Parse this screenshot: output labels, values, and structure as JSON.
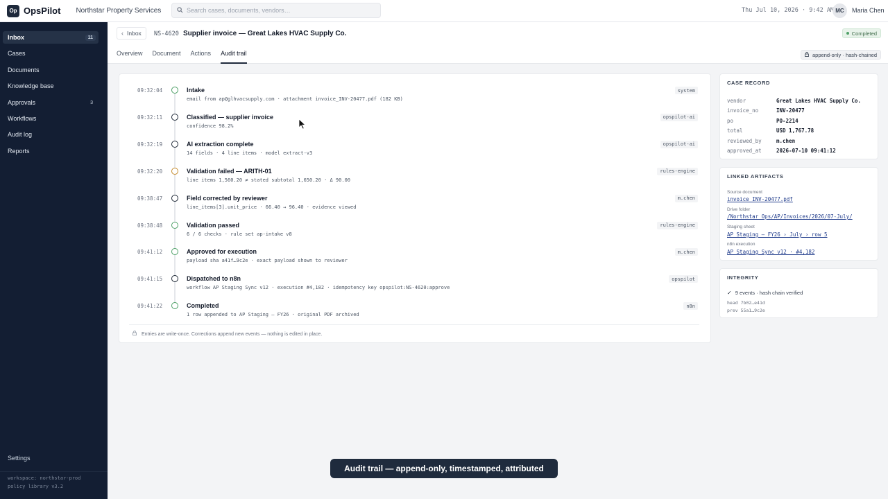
{
  "app": {
    "name": "OpsPilot",
    "logo_text": "Op",
    "org": "Northstar Property Services"
  },
  "search": {
    "placeholder": "Search cases, documents, vendors…"
  },
  "header_right": {
    "datetime": "Thu Jul 10, 2026 · 9:42 AM",
    "initials": "MC",
    "user": "Maria Chen"
  },
  "sidebar": {
    "items": [
      {
        "label": "Inbox",
        "count": "11"
      },
      {
        "label": "Cases"
      },
      {
        "label": "Documents"
      },
      {
        "label": "Knowledge base"
      },
      {
        "label": "Approvals",
        "count": "3"
      },
      {
        "label": "Workflows"
      },
      {
        "label": "Audit log"
      },
      {
        "label": "Reports"
      }
    ],
    "settings": "Settings",
    "workspace": "workspace: northstar-prod",
    "policy": "policy library v3.2"
  },
  "case": {
    "back_label": "Inbox",
    "id": "NS-4620",
    "title": "Supplier invoice — Great Lakes HVAC Supply Co.",
    "status": "Completed",
    "tabs": [
      "Overview",
      "Document",
      "Actions",
      "Audit trail"
    ],
    "active_tab": "Audit trail",
    "chain_chip": "append-only · hash-chained"
  },
  "audit": {
    "events": [
      {
        "time": "09:32:04",
        "title": "Intake",
        "detail": "email from ap@glhvacsupply.com · attachment invoice_INV-20477.pdf (182 KB)",
        "actor": "system",
        "marker": "green"
      },
      {
        "time": "09:32:11",
        "title": "Classified — supplier invoice",
        "detail": "confidence 98.2%",
        "actor": "opspilot-ai",
        "marker": "dark"
      },
      {
        "time": "09:32:19",
        "title": "AI extraction complete",
        "detail": "14 fields · 4 line items · model extract-v3",
        "actor": "opspilot-ai",
        "marker": "dark"
      },
      {
        "time": "09:32:20",
        "title": "Validation failed — ARITH-01",
        "detail": "line items 1,560.20 ≠ stated subtotal 1,650.20 · Δ 90.00",
        "actor": "rules-engine",
        "marker": "amber"
      },
      {
        "time": "09:38:47",
        "title": "Field corrected by reviewer",
        "detail": "line_items[3].unit_price · 66.40 → 96.40 · evidence viewed",
        "actor": "m.chen",
        "marker": "dark"
      },
      {
        "time": "09:38:48",
        "title": "Validation passed",
        "detail": "6 / 6 checks · rule set ap-intake v8",
        "actor": "rules-engine",
        "marker": "green"
      },
      {
        "time": "09:41:12",
        "title": "Approved for execution",
        "detail": "payload sha a41f…9c2e · exact payload shown to reviewer",
        "actor": "m.chen",
        "marker": "green"
      },
      {
        "time": "09:41:15",
        "title": "Dispatched to n8n",
        "detail": "workflow AP Staging Sync v12 · execution #4,182 · idempotency key opspilot:NS-4620:approve",
        "actor": "opspilot",
        "marker": "dark"
      },
      {
        "time": "09:41:22",
        "title": "Completed",
        "detail": "1 row appended to AP Staging — FY26 · original PDF archived",
        "actor": "n8n",
        "marker": "green"
      }
    ],
    "footer": "Entries are write-once. Corrections append new events — nothing is edited in place."
  },
  "case_record": {
    "title": "CASE RECORD",
    "rows": [
      {
        "key": "vendor",
        "value": "Great Lakes HVAC Supply Co."
      },
      {
        "key": "invoice_no",
        "value": "INV-20477"
      },
      {
        "key": "po",
        "value": "PO-2214"
      },
      {
        "key": "total",
        "value": "USD 1,767.78"
      },
      {
        "key": "reviewed_by",
        "value": "m.chen"
      },
      {
        "key": "approved_at",
        "value": "2026-07-10 09:41:12"
      }
    ]
  },
  "linked_artifacts": {
    "title": "LINKED ARTIFACTS",
    "items": [
      {
        "label": "Source document",
        "link": "invoice_INV-20477.pdf"
      },
      {
        "label": "Drive folder",
        "link": "/Northstar Ops/AP/Invoices/2026/07-July/"
      },
      {
        "label": "Staging sheet",
        "link": "AP Staging — FY26 › July › row 5"
      },
      {
        "label": "n8n execution",
        "link": "AP Staging Sync v12 · #4,182"
      }
    ]
  },
  "integrity": {
    "title": "INTEGRITY",
    "status": "9 events · hash chain verified",
    "head": "head 7b02…e41d",
    "prev": "prev 55a1…9c2e"
  },
  "caption": "Audit trail — append-only, timestamped, attributed",
  "colors": {
    "sidebar": "#131e33",
    "accent_green": "#4ea067",
    "amber": "#c58b2c"
  }
}
